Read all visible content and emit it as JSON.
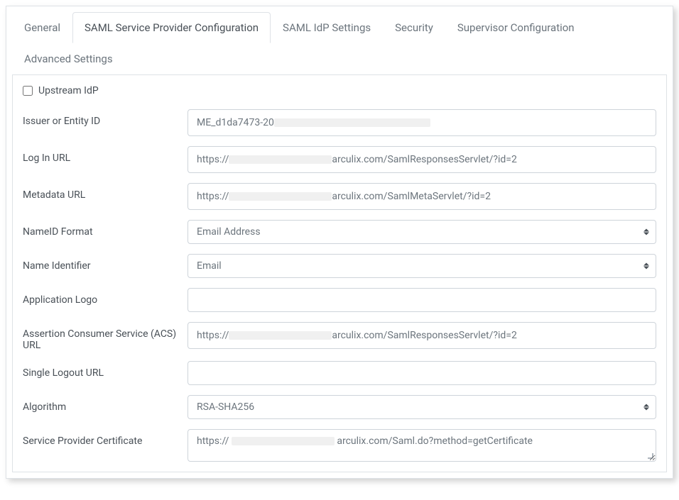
{
  "tabs": {
    "general": "General",
    "saml_sp": "SAML Service Provider Configuration",
    "saml_idp": "SAML IdP Settings",
    "security": "Security",
    "supervisor": "Supervisor Configuration",
    "advanced": "Advanced Settings"
  },
  "form": {
    "upstream_idp": {
      "label": "Upstream IdP",
      "checked": false
    },
    "issuer": {
      "label": "Issuer or Entity ID",
      "value_prefix": "ME_d1da7473-20",
      "value_suffix": ""
    },
    "login_url": {
      "label": "Log In URL",
      "value_prefix": "https://",
      "value_suffix": "arculix.com/SamlResponsesServlet/?id=2"
    },
    "metadata_url": {
      "label": "Metadata URL",
      "value_prefix": "https://",
      "value_suffix": "arculix.com/SamlMetaServlet/?id=2"
    },
    "nameid_format": {
      "label": "NameID Format",
      "value": "Email Address"
    },
    "name_identifier": {
      "label": "Name Identifier",
      "value": "Email"
    },
    "app_logo": {
      "label": "Application Logo",
      "value": ""
    },
    "acs_url": {
      "label": "Assertion Consumer Service (ACS) URL",
      "value_prefix": "https://",
      "value_suffix": "arculix.com/SamlResponsesServlet/?id=2"
    },
    "slo_url": {
      "label": "Single Logout URL",
      "value": ""
    },
    "algorithm": {
      "label": "Algorithm",
      "value": "RSA-SHA256"
    },
    "sp_cert": {
      "label": "Service Provider Certificate",
      "value_prefix": "https://",
      "value_suffix": "arculix.com/Saml.do?method=getCertificate"
    }
  }
}
